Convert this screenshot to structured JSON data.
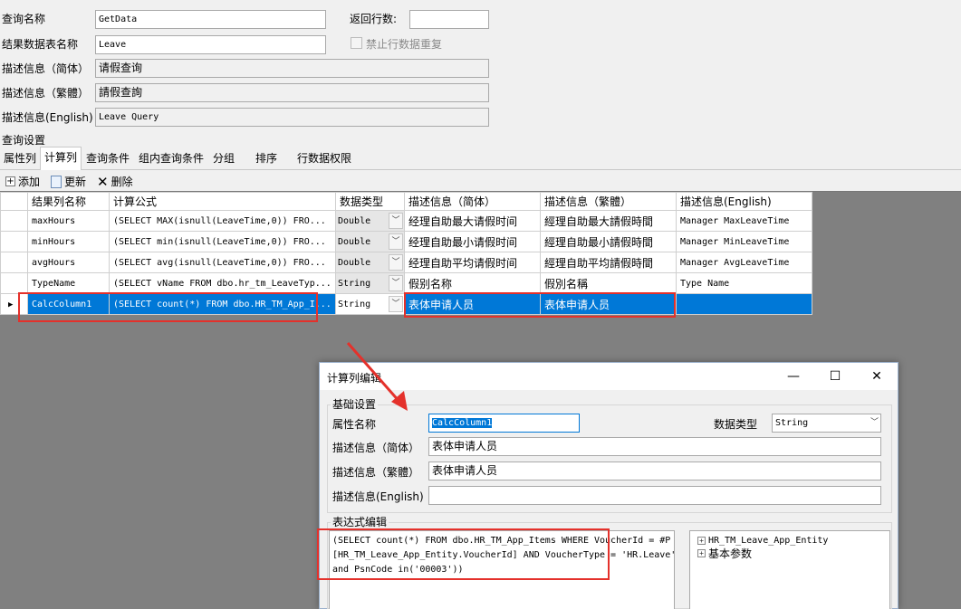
{
  "form": {
    "query_name_label": "查询名称",
    "query_name_value": "GetData",
    "return_rows_label": "返回行数:",
    "return_rows_value": "",
    "result_table_label": "结果数据表名称",
    "result_table_value": "Leave",
    "no_dup_label": "禁止行数据重复",
    "desc_cn_label": "描述信息（简体）",
    "desc_cn_value": "请假查询",
    "desc_tw_label": "描述信息（繁體）",
    "desc_tw_value": "請假查詢",
    "desc_en_label": "描述信息(English)",
    "desc_en_value": "Leave Query",
    "settings_label": "查询设置"
  },
  "tabs": [
    "属性列",
    "计算列",
    "查询条件",
    "组内查询条件",
    "分组",
    "排序",
    "行数据权限"
  ],
  "toolbar": {
    "add": "添加",
    "update": "更新",
    "delete": "删除"
  },
  "grid": {
    "headers": [
      "结果列名称",
      "计算公式",
      "数据类型",
      "描述信息（简体）",
      "描述信息（繁體）",
      "描述信息(English)"
    ],
    "rows": [
      {
        "name": "maxHours",
        "formula": "(SELECT MAX(isnull(LeaveTime,0))  FRO...",
        "type": "Double",
        "cn": "经理自助最大请假时间",
        "tw": "經理自助最大請假時間",
        "en": "Manager MaxLeaveTime"
      },
      {
        "name": "minHours",
        "formula": "(SELECT min(isnull(LeaveTime,0))  FRO...",
        "type": "Double",
        "cn": "经理自助最小请假时间",
        "tw": "經理自助最小請假時間",
        "en": "Manager MinLeaveTime"
      },
      {
        "name": "avgHours",
        "formula": "(SELECT avg(isnull(LeaveTime,0))  FRO...",
        "type": "Double",
        "cn": "经理自助平均请假时间",
        "tw": "經理自助平均請假時間",
        "en": "Manager AvgLeaveTime"
      },
      {
        "name": "TypeName",
        "formula": "(SELECT vName FROM dbo.hr_tm_LeaveTyp...",
        "type": "String",
        "cn": "假别名称",
        "tw": "假別名稱",
        "en": "Type Name"
      },
      {
        "name": "CalcColumn1",
        "formula": "(SELECT count(*) FROM dbo.HR_TM_App_I...",
        "type": "String",
        "cn": "表体申请人员",
        "tw": "表体申请人员",
        "en": ""
      }
    ]
  },
  "dialog": {
    "title": "计算列编辑",
    "basic_group": "基础设置",
    "prop_name_label": "属性名称",
    "prop_name_value": "CalcColumn1",
    "data_type_label": "数据类型",
    "data_type_value": "String",
    "desc_cn_label": "描述信息（简体）",
    "desc_cn_value": "表体申请人员",
    "desc_tw_label": "描述信息（繁體）",
    "desc_tw_value": "表体申请人员",
    "desc_en_label": "描述信息(English)",
    "desc_en_value": "",
    "expr_group": "表达式编辑",
    "expression": "(SELECT count(*) FROM dbo.HR_TM_App_Items WHERE VoucherId = #P\n[HR_TM_Leave_App_Entity.VoucherId] AND VoucherType = 'HR.Leave'\nand PsnCode in('00003'))",
    "tree": [
      "HR_TM_Leave_App_Entity",
      "基本参数"
    ]
  },
  "colors": {
    "selection": "#0078d7",
    "highlight": "#e4312b"
  }
}
